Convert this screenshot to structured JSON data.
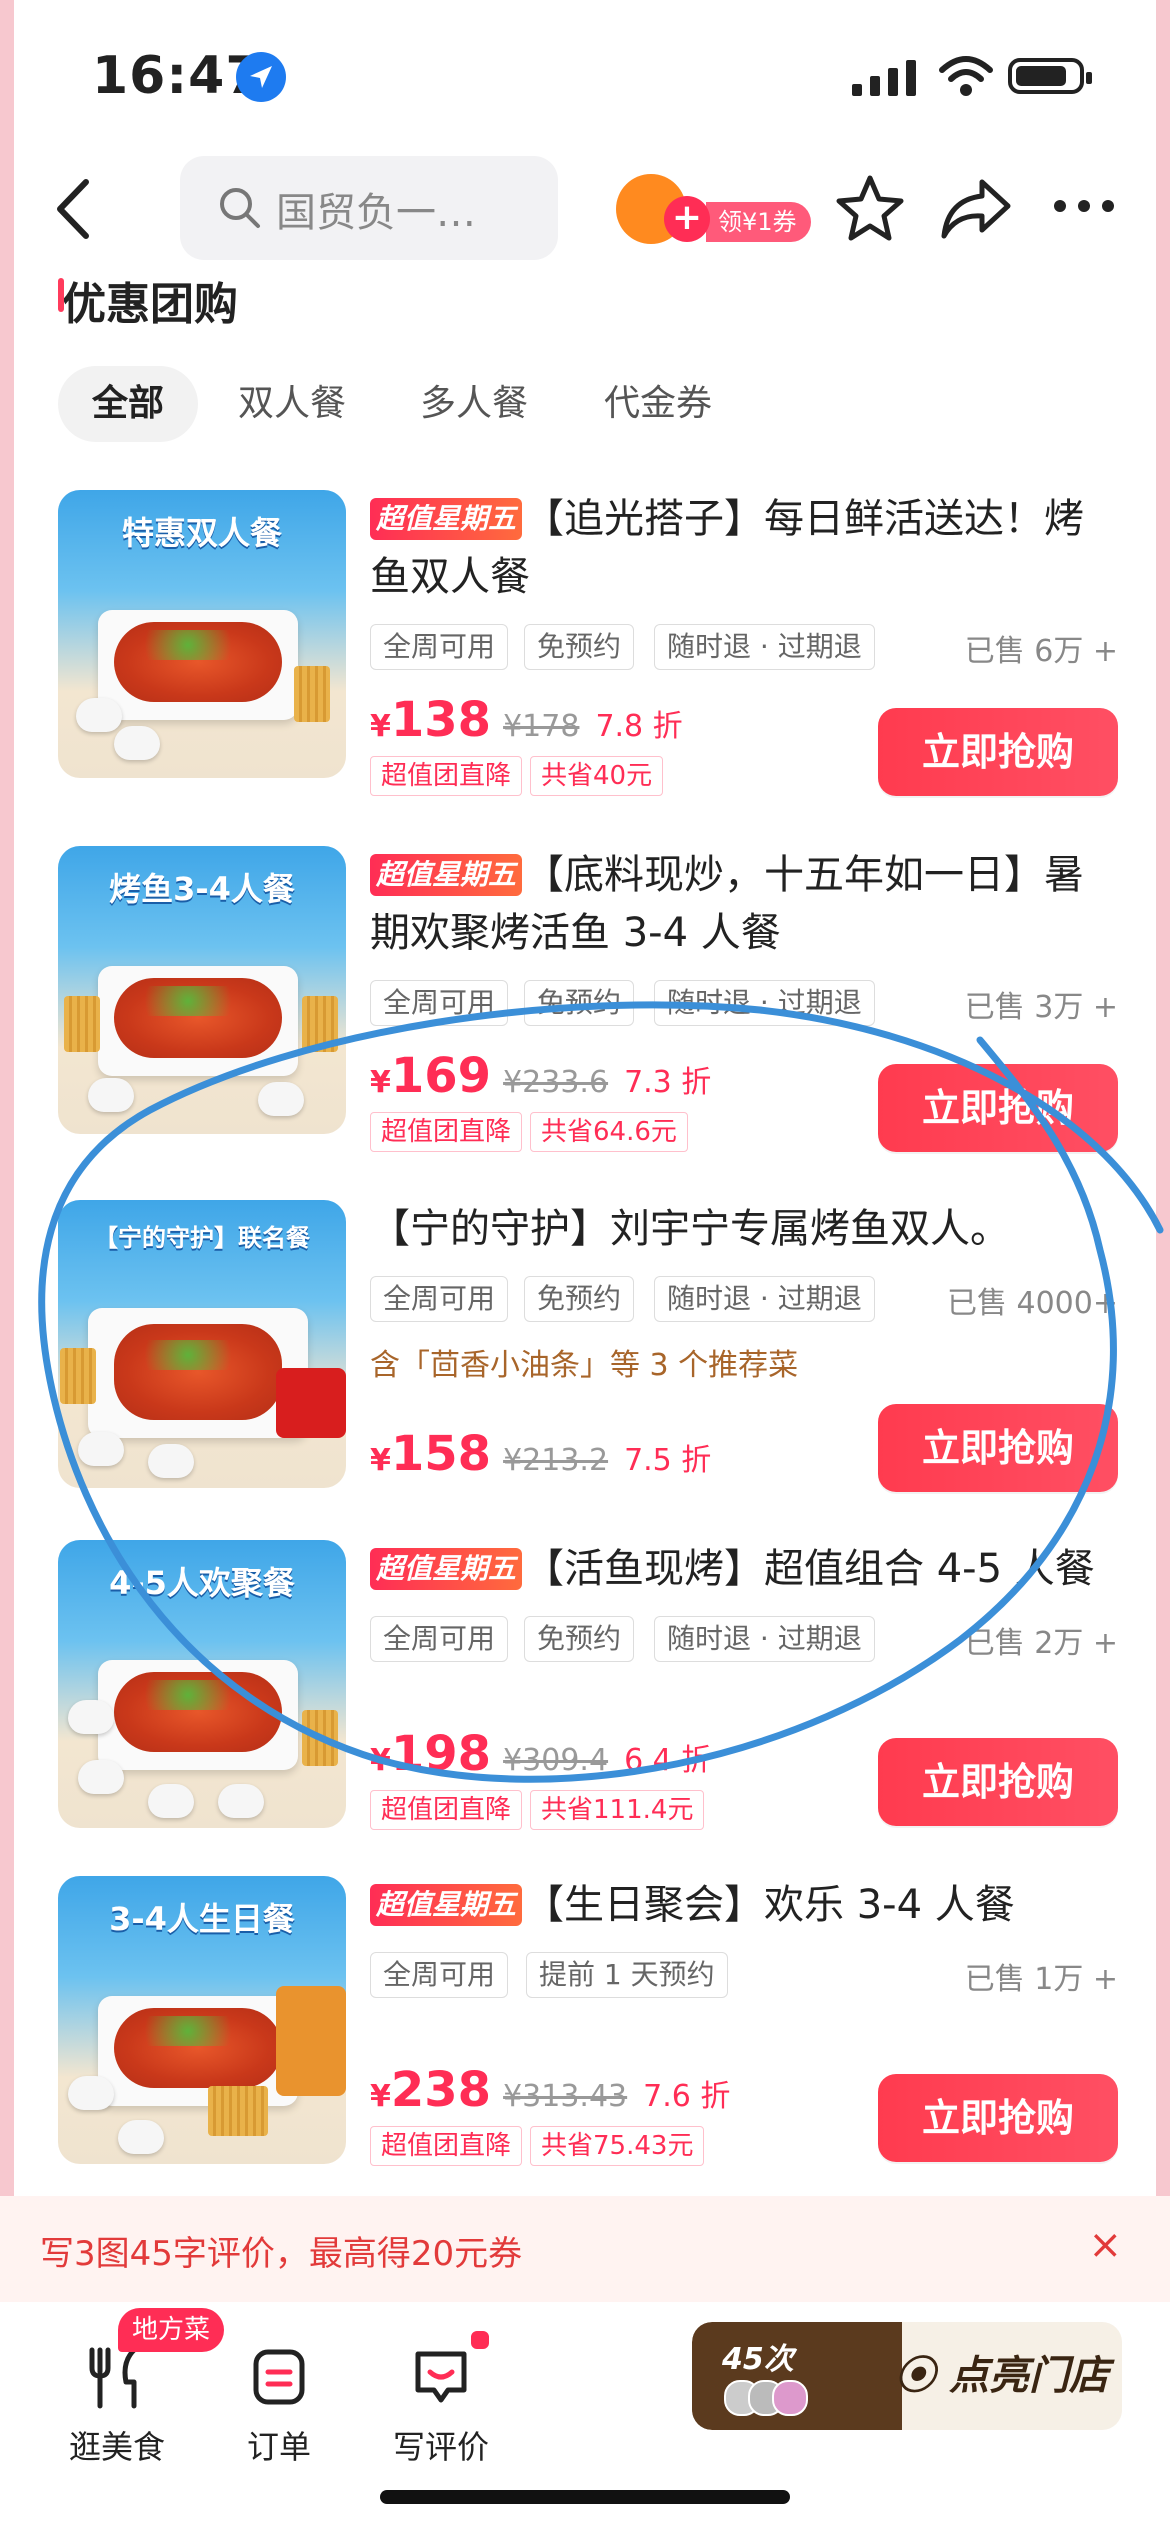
{
  "status": {
    "time": "16:47"
  },
  "nav": {
    "search_placeholder": "国贸负一…",
    "coupon_label": "领¥1券"
  },
  "section": {
    "title": "优惠团购"
  },
  "tabs": [
    "全部",
    "双人餐",
    "多人餐",
    "代金券"
  ],
  "deals": [
    {
      "banner": "特惠双人餐",
      "badge": "超值星期五",
      "title": "【追光搭子】每日鲜活送达！烤鱼双人餐",
      "tags": [
        "全周可用",
        "免预约",
        "随时退 · 过期退"
      ],
      "sold": "已售 6万 +",
      "price": "138",
      "original": "¥178",
      "discount": "7.8 折",
      "chips": [
        "超值团直降",
        "共省40元"
      ],
      "button": "立即抢购"
    },
    {
      "banner": "烤鱼3-4人餐",
      "badge": "超值星期五",
      "title": "【底料现炒，十五年如一日】暑期欢聚烤活鱼 3-4 人餐",
      "tags": [
        "全周可用",
        "免预约",
        "随时退 · 过期退"
      ],
      "sold": "已售 3万 +",
      "price": "169",
      "original": "¥233.6",
      "discount": "7.3 折",
      "chips": [
        "超值团直降",
        "共省64.6元"
      ],
      "button": "立即抢购"
    },
    {
      "banner": "【宁的守护】联名餐",
      "title": "【宁的守护】刘宇宁专属烤鱼双人。",
      "tags": [
        "全周可用",
        "免预约",
        "随时退 · 过期退"
      ],
      "sold": "已售 4000+",
      "recommend": "含「茴香小油条」等 3 个推荐菜",
      "price": "158",
      "original": "¥213.2",
      "discount": "7.5 折",
      "button": "立即抢购"
    },
    {
      "banner": "4-5人欢聚餐",
      "badge": "超值星期五",
      "title": "【活鱼现烤】超值组合 4-5 人餐",
      "tags": [
        "全周可用",
        "免预约",
        "随时退 · 过期退"
      ],
      "sold": "已售 2万 +",
      "price": "198",
      "original": "¥309.4",
      "discount": "6.4 折",
      "chips": [
        "超值团直降",
        "共省111.4元"
      ],
      "button": "立即抢购"
    },
    {
      "banner": "3-4人生日餐",
      "badge": "超值星期五",
      "title": "【生日聚会】欢乐 3-4 人餐",
      "tags": [
        "全周可用",
        "提前 1 天预约"
      ],
      "sold": "已售 1万 +",
      "price": "238",
      "original": "¥313.43",
      "discount": "7.6 折",
      "chips": [
        "超值团直降",
        "共省75.43元"
      ],
      "button": "立即抢购"
    }
  ],
  "review_banner": {
    "text": "写3图45字评价，最高得20元券",
    "close": "×"
  },
  "bottom": {
    "tabs": [
      "逛美食",
      "订单",
      "写评价"
    ],
    "hot_badge": "地方菜",
    "visits": "45次",
    "light_button": "点亮门店"
  },
  "colors": {
    "accent": "#ff2d55",
    "annotation": "#3b8fd8"
  }
}
